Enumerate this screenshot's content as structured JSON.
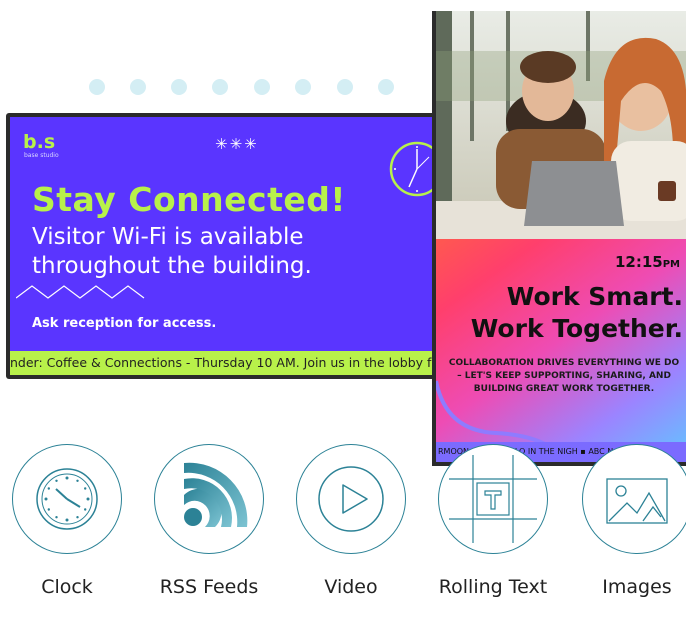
{
  "left_screen": {
    "logo": "b.s",
    "logo_sub": "base studio",
    "stars": "✳✳✳",
    "headline": "Stay Connected!",
    "subline1": "Visitor Wi-Fi is available",
    "subline2": "throughout the building.",
    "cta": "Ask reception for access.",
    "ticker": "nder: Coffee & Connections - Thursday 10 AM. Join us in the lobby for fre"
  },
  "right_screen": {
    "time": "12:15",
    "time_suffix": "PM",
    "title_line1": "Work Smart.",
    "title_line2": "Work Together.",
    "body": "COLLABORATION DRIVES EVERYTHING WE DO – LET'S KEEP SUPPORTING, SHARING, AND BUILDING GREAT WORK TOGETHER.",
    "ticker": "RMOON ▪ ITH A HALO IN THE NIGH ▪ ABC N"
  },
  "features": [
    {
      "label": "Clock",
      "icon": "clock-icon"
    },
    {
      "label": "RSS Feeds",
      "icon": "rss-icon"
    },
    {
      "label": "Video",
      "icon": "play-icon"
    },
    {
      "label": "Rolling Text",
      "icon": "text-frame-icon"
    },
    {
      "label": "Images",
      "icon": "image-icon"
    }
  ],
  "colors": {
    "purple": "#5a35ff",
    "lime": "#b8f14a",
    "teal": "#2c8296",
    "dot": "#d4eef4"
  }
}
